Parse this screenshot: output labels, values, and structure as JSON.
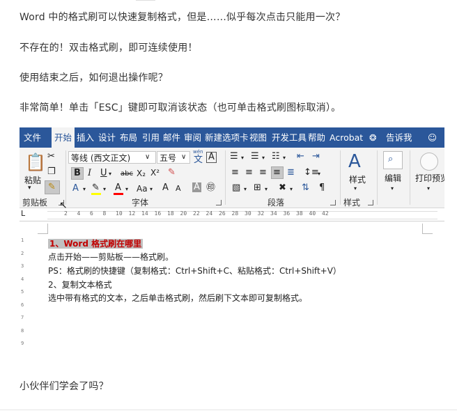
{
  "article": {
    "p1": "Word 中的格式刷可以快速复制格式，但是……似乎每次点击只能用一次？",
    "p2": "不存在的！双击格式刷，即可连续使用！",
    "p3": "使用结束之后，如何退出操作呢？",
    "p4": "非常简单！单击「ESC」键即可取消该状态（也可单击格式刷图标取消）。",
    "p5": "小伙伴们学会了吗？"
  },
  "word": {
    "tabs": [
      "文件",
      "开始",
      "插入",
      "设计",
      "布局",
      "引用",
      "邮件",
      "审阅",
      "新建选项卡",
      "视图",
      "开发工具",
      "帮助",
      "Acrobat",
      "告诉我"
    ],
    "active_tab": "开始",
    "ribbon": {
      "paste_label": "粘贴",
      "font_name": "等线 (西文正文)",
      "font_size": "五号",
      "styles_label": "样式",
      "edit_label": "编辑",
      "print_preview_label": "打印预览",
      "groups": {
        "clipboard": "剪贴板",
        "font": "字体",
        "paragraph": "段落",
        "styles": "样式"
      },
      "font_buttons": {
        "bold": "B",
        "italic": "I",
        "underline": "U",
        "strike": "abc",
        "subscript": "X₂",
        "superscript": "X²",
        "font_color_A": "A",
        "change_case": "Aa",
        "grow": "A",
        "shrink": "A",
        "wen": "文",
        "wen_small": "wén"
      }
    },
    "ruler_numbers": [
      "2",
      "4",
      "6",
      "8",
      "10",
      "12",
      "14",
      "16",
      "18",
      "20",
      "22",
      "24",
      "26",
      "28",
      "30",
      "32",
      "34",
      "36",
      "38",
      "40",
      "42"
    ],
    "vruler_numbers": [
      "1",
      "2",
      "3",
      "4",
      "5",
      "6",
      "7",
      "8",
      "9"
    ],
    "document": {
      "heading": "1、Word 格式刷在哪里",
      "line2": "点击开始——剪贴板——格式刷。",
      "line3": "PS：格式刷的快捷键（复制格式：Ctrl+Shift+C、粘贴格式：Ctrl+Shift+V）",
      "line4": "2、复制文本格式",
      "line5": "选中带有格式的文本，之后单击格式刷，然后刷下文本即可复制格式。"
    },
    "colors": {
      "tabbar": "#2b579a",
      "heading_text": "#c00000",
      "heading_highlight": "#c0c0c0",
      "highlight_yellow": "#ffff00",
      "font_red": "#ff0000"
    }
  }
}
